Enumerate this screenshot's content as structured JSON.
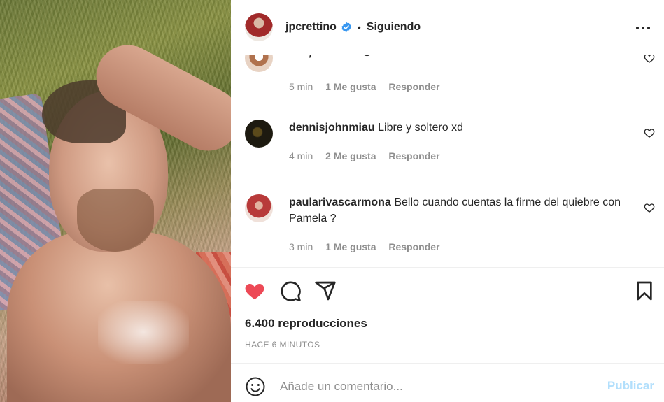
{
  "post": {
    "username": "jpcrettino",
    "verified": true,
    "follow_status": "Siguiendo",
    "separator": "•"
  },
  "comments": [
    {
      "username": "benjaberenia",
      "text": "",
      "emoji": "😉",
      "time": "5 min",
      "likes": "1 Me gusta",
      "reply": "Responder"
    },
    {
      "username": "dennisjohnmiau",
      "text": "Libre y soltero xd",
      "time": "4 min",
      "likes": "2 Me gusta",
      "reply": "Responder"
    },
    {
      "username": "paularivascarmona",
      "text": "Bello cuando cuentas la firme del quiebre con Pamela ?",
      "time": "3 min",
      "likes": "1 Me gusta",
      "reply": "Responder"
    }
  ],
  "actions": {
    "liked": true,
    "like_color": "#ed4956",
    "icons": [
      "heart-icon",
      "comment-icon",
      "share-icon",
      "bookmark-icon"
    ]
  },
  "views": "6.400 reproducciones",
  "posted_time": "HACE 6 MINUTOS",
  "add_comment": {
    "placeholder": "Añade un comentario...",
    "publish_label": "Publicar",
    "publish_color": "#b2dffc"
  }
}
